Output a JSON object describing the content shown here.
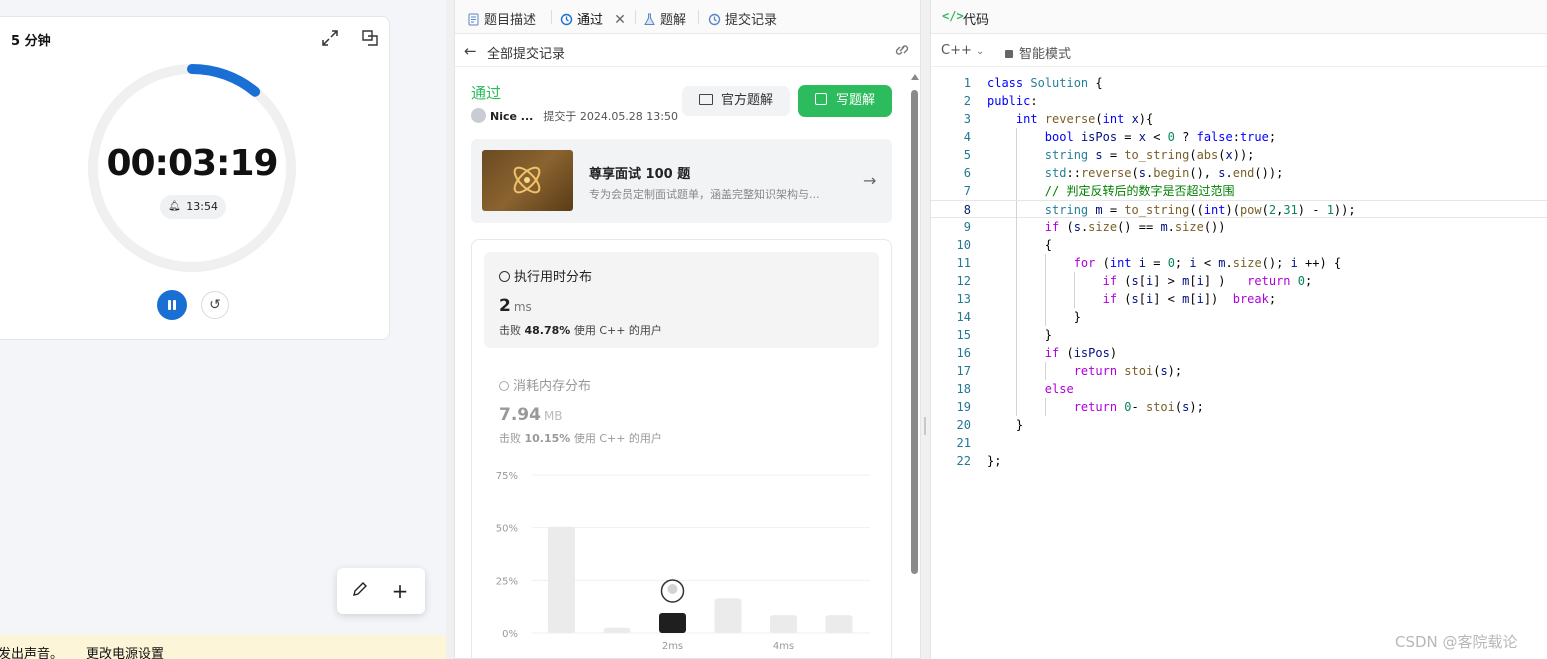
{
  "timer": {
    "title": "5 分钟",
    "time": "00:03:19",
    "alarm": "13:54",
    "progress_fraction": 0.11
  },
  "left_notice": {
    "text_a": "发出声音。",
    "text_b": "更改电源设置"
  },
  "tabs": [
    {
      "label": "题目描述",
      "icon": "description-icon"
    },
    {
      "label": "通过",
      "icon": "history-icon",
      "active": true,
      "closable": true
    },
    {
      "label": "题解",
      "icon": "flask-icon"
    },
    {
      "label": "提交记录",
      "icon": "history-icon"
    }
  ],
  "submission": {
    "back_label": "全部提交记录",
    "status": "通过",
    "author": "Nice ...",
    "submitted_at": "提交于 2024.05.28 13:50",
    "btn_official": "官方题解",
    "btn_write": "写题解"
  },
  "promo": {
    "title": "尊享面试 100 题",
    "subtitle": "专为会员定制面试题单，涵盖完整知识架构与..."
  },
  "runtime": {
    "title": "执行用时分布",
    "value": "2",
    "unit": "ms",
    "beat_prefix": "击败",
    "beat_pct": "48.78%",
    "beat_suffix": "使用 C++ 的用户"
  },
  "memory": {
    "title": "消耗内存分布",
    "value": "7.94",
    "unit": "MB",
    "beat_prefix": "击败",
    "beat_pct": "10.15%",
    "beat_suffix": "使用 C++ 的用户"
  },
  "chart_data": {
    "type": "bar",
    "y_ticks": [
      "75%",
      "50%",
      "25%",
      "0%"
    ],
    "ylim": [
      0,
      75
    ],
    "x_tick_labels": [
      {
        "label": "2ms",
        "bar_index": 2
      },
      {
        "label": "4ms",
        "bar_index": 4
      }
    ],
    "values": [
      50.5,
      2.5,
      9.5,
      16.5,
      8.5,
      8.5
    ],
    "highlight_index": 2,
    "colors": {
      "bar": "#ebebeb",
      "highlight": "#1f1f1f",
      "grid": "#efefef"
    }
  },
  "editor": {
    "header": "代码",
    "language": "C++",
    "mode": "智能模式",
    "active_line": 8,
    "lines": [
      "class Solution {",
      "public:",
      "    int reverse(int x){",
      "        bool isPos = x < 0 ? false:true;",
      "        string s = to_string(abs(x));",
      "        std::reverse(s.begin(), s.end());",
      "        // 判定反转后的数字是否超过范围",
      "        string m = to_string((int)(pow(2,31) - 1));",
      "        if (s.size() == m.size())",
      "        {",
      "            for (int i = 0; i < m.size(); i ++) {",
      "                if (s[i] > m[i] )   return 0;",
      "                if (s[i] < m[i])  break;",
      "            }",
      "        }",
      "        if (isPos)",
      "            return stoi(s);",
      "        else",
      "            return 0- stoi(s);",
      "    }",
      "",
      "};"
    ]
  },
  "watermark": "CSDN @客院载论"
}
